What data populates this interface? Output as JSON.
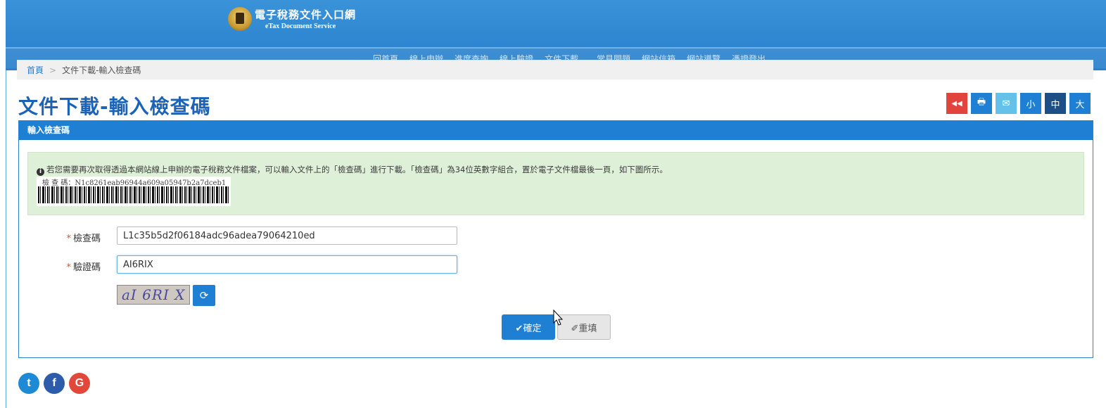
{
  "header": {
    "title": "電子稅務文件入口網",
    "subtitle": "eTax Document Service"
  },
  "nav": {
    "items": [
      "回首頁",
      "線上申辦",
      "進度查詢",
      "線上驗證",
      "文件下載⌄",
      "常見問題",
      "網站信箱",
      "網站導覽",
      "憑證登出"
    ]
  },
  "breadcrumb": {
    "home": "首頁",
    "separator": ">",
    "current": "文件下載-輸入檢查碼"
  },
  "page": {
    "title": "文件下載-輸入檢查碼"
  },
  "toolbar": {
    "back_icon": "◀◀",
    "print_icon": "🖶",
    "mail_icon": "✉",
    "small": "小",
    "medium": "中",
    "large": "大"
  },
  "panel": {
    "heading": "輸入檢查碼",
    "notice": "若您需要再次取得透過本網站線上申辦的電子稅務文件檔案，可以輸入文件上的「檢查碼」進行下載。「檢查碼」為34位英數字組合，置於電子文件檔最後一頁，如下圖所示。",
    "barcode_label": "檢 查 碼：N1c8261eab96944a609a05947b2a7dceb1"
  },
  "form": {
    "checkcode_label": "檢查碼",
    "checkcode_value": "L1c35b5d2f06184adc96adea79064210ed",
    "verify_label": "驗證碼",
    "verify_value": "AI6RIX",
    "captcha_text": "aI 6RI X",
    "required_mark": "*",
    "submit_label": "✔確定",
    "reset_label": "✐重填"
  },
  "social": {
    "twitter": "t",
    "facebook": "f",
    "google": "G"
  },
  "colors": {
    "brand": "#1e7fd3",
    "danger": "#e0443c",
    "notice_bg": "#dff0d8"
  }
}
